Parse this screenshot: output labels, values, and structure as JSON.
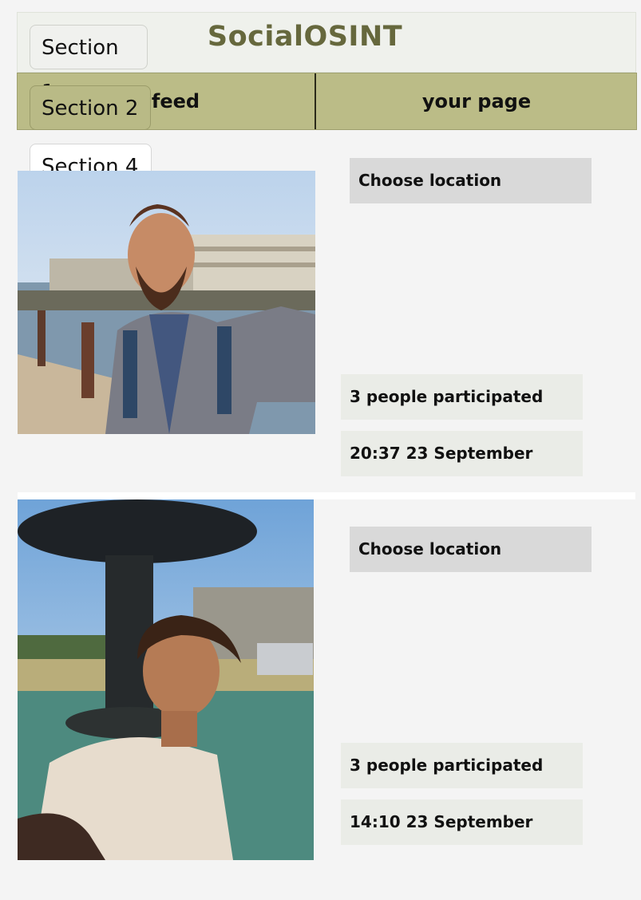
{
  "app": {
    "title": "SocialOSINT"
  },
  "tabs": [
    {
      "label": "y feed"
    },
    {
      "label": "your page"
    }
  ],
  "sections": [
    {
      "label": "Section 1"
    },
    {
      "label": "Section 2"
    },
    {
      "label": "Section 4"
    }
  ],
  "posts": [
    {
      "location_button": "Choose location",
      "participants": "3 people participated",
      "timestamp": "20:37 23 September"
    },
    {
      "location_button": "Choose location",
      "participants": "3 people participated",
      "timestamp": "14:10 23 September"
    }
  ],
  "colors": {
    "brand": "#66683d",
    "tab_bar": "#bbbc87",
    "header_bg": "#eff1ec",
    "location_button": "#d9d9d9",
    "info_box": "#eaece7"
  }
}
